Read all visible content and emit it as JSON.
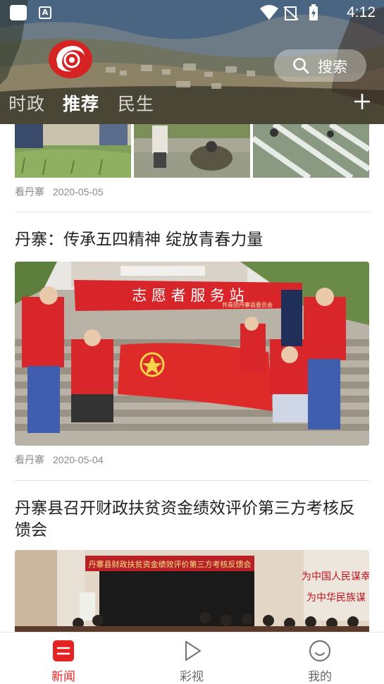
{
  "status_bar": {
    "time": "4:12",
    "icons": [
      "app-square-icon",
      "a-icon",
      "wifi-icon",
      "no-sim-icon",
      "battery-charging-icon"
    ]
  },
  "header": {
    "logo_icon": "red-swirl-logo-icon",
    "search_label": "搜索",
    "channels": [
      {
        "label": "时政",
        "active": false
      },
      {
        "label": "推荐",
        "active": true
      },
      {
        "label": "民生",
        "active": false
      }
    ],
    "add_icon": "plus-icon"
  },
  "feed": {
    "items": [
      {
        "source": "看丹寨",
        "date": "2020-05-05"
      },
      {
        "title": "丹寨：传承五四精神 绽放青春力量",
        "source": "看丹寨",
        "date": "2020-05-04",
        "banner_text": "志 愿 者 服 务 站",
        "banner_sub": "共青团丹寨县委员会"
      },
      {
        "title": "丹寨县召开财政扶贫资金绩效评价第三方考核反馈会",
        "banner_text": "丹寨县财政扶贫资金绩效评价第三方考核反馈会",
        "wall_text": [
          "为中国人民谋幸",
          "为中华民族谋"
        ]
      }
    ]
  },
  "bottom_nav": {
    "items": [
      {
        "label": "新闻",
        "icon": "news-icon",
        "active": true
      },
      {
        "label": "彩视",
        "icon": "play-icon",
        "active": false
      },
      {
        "label": "我的",
        "icon": "smiley-icon",
        "active": false
      }
    ]
  },
  "colors": {
    "accent": "#e52323",
    "meta_text": "#8b8b8b"
  }
}
